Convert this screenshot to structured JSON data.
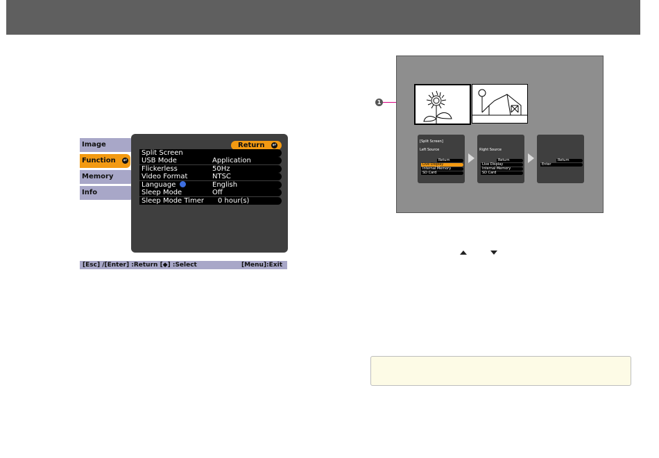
{
  "menu": {
    "tabs": [
      {
        "label": "Image"
      },
      {
        "label": "Function"
      },
      {
        "label": "Memory"
      },
      {
        "label": "Info"
      }
    ],
    "active_tab": "Function",
    "return_label": "Return",
    "rows": [
      {
        "key": "Split Screen",
        "value": ""
      },
      {
        "key": "USB Mode",
        "value": "Application"
      },
      {
        "key": "Flickerless",
        "value": "50Hz"
      },
      {
        "key": "Video Format",
        "value": "NTSC"
      },
      {
        "key": "Language",
        "value": "English"
      },
      {
        "key": "Sleep Mode",
        "value": "Off"
      },
      {
        "key": "Sleep Mode Timer",
        "value": "0 hour(s)"
      }
    ],
    "footer_left": "[Esc] /[Enter] :Return  [◆] :Select",
    "footer_right": "[Menu]:Exit"
  },
  "illustration": {
    "callout_number": "1",
    "panel1": {
      "header": "[Split Screen]",
      "sub": "Left Source",
      "return": "Return",
      "items": [
        "Live Display",
        "Internal Memory",
        "SD Card"
      ],
      "selected": "Live Display"
    },
    "panel2": {
      "header": "Right Source",
      "return": "Return",
      "items": [
        "Live Display",
        "Internal Memory",
        "SD Card"
      ]
    },
    "panel3": {
      "return": "Return",
      "items": [
        "Enter"
      ]
    }
  },
  "colors": {
    "accent": "#f39a12",
    "tab": "#a8a7c8",
    "panel": "#3f3f3f",
    "topbar": "#5f5f5f"
  }
}
